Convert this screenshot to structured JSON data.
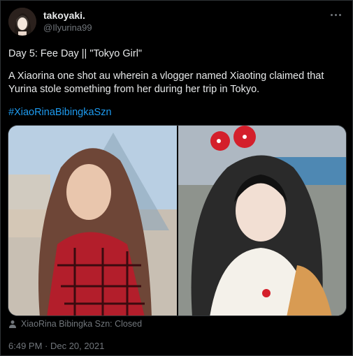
{
  "tweet": {
    "display_name": "takoyaki.",
    "handle": "@Ilyurina99",
    "line1": "Day 5: Fee Day || \"Tokyo Girl\"",
    "line2": "A Xiaorina one shot au wherein a vlogger named Xiaoting claimed that Yurina stole something from her during her trip in Tokyo.",
    "hashtag": "#XiaoRinaBibingkaSzn",
    "closed_label": "XiaoRina Bibingka Szn: Closed",
    "timestamp": "6:49 PM · Dec 20, 2021"
  },
  "icons": {
    "more": "more-dots-icon",
    "community": "person-icon"
  },
  "colors": {
    "background": "#000000",
    "text": "#e7e9ea",
    "muted": "#71767b",
    "link": "#1d9bf0"
  }
}
